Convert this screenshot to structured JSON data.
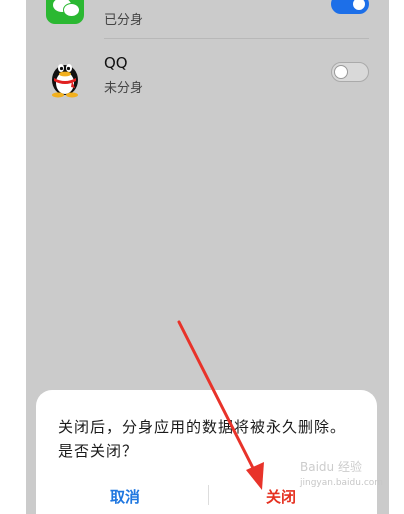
{
  "apps": [
    {
      "name": "",
      "status": "已分身",
      "icon": "wechat-icon",
      "toggle_on": true
    },
    {
      "name": "QQ",
      "status": "未分身",
      "icon": "qq-penguin-icon",
      "toggle_on": false
    }
  ],
  "dialog": {
    "message": "关闭后，分身应用的数据将被永久删除。是否关闭？",
    "cancel_label": "取消",
    "confirm_label": "关闭"
  },
  "colors": {
    "accent_blue": "#1d6fe8",
    "danger_red": "#e53121",
    "annotation_red": "#e8332a"
  },
  "watermark": {
    "text": "Baidu 经验",
    "sub": "jingyan.baidu.com"
  }
}
